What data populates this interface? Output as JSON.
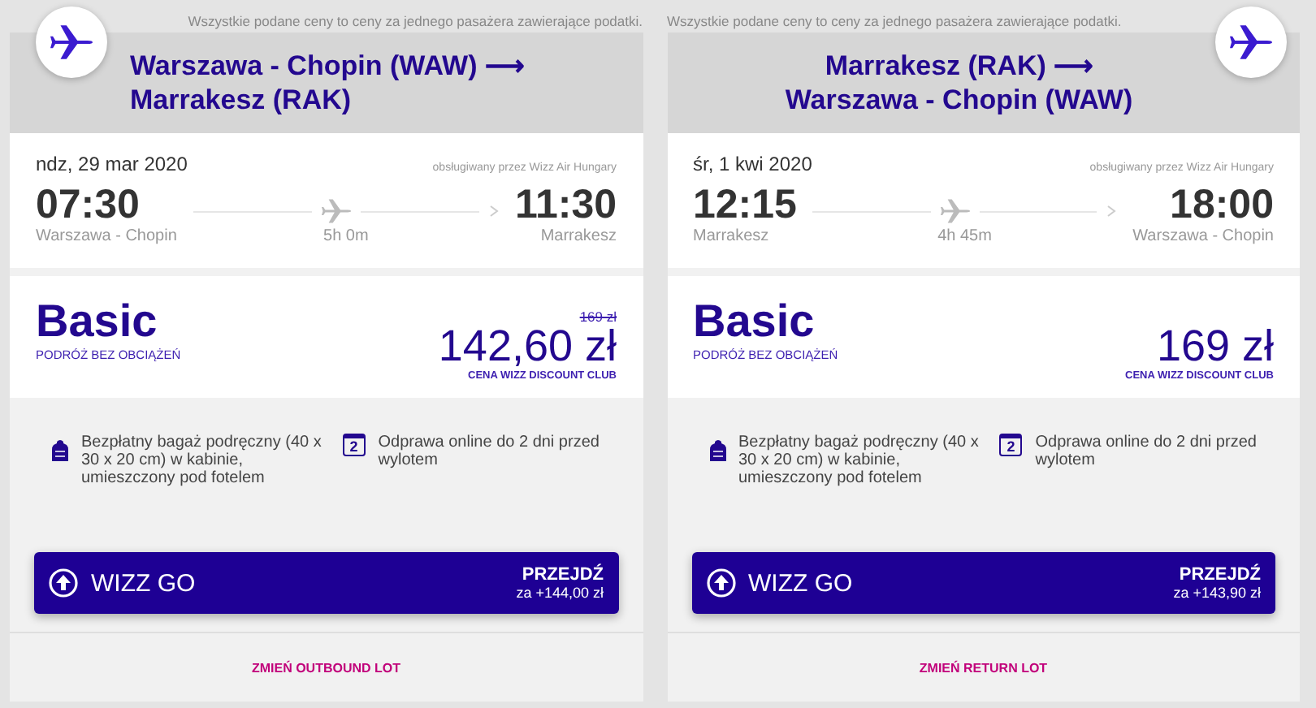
{
  "cards": [
    {
      "kind": "outbound",
      "notice": "Wszystkie podane ceny to ceny za jednego pasażera zawierające podatki.",
      "route": "Warszawa - Chopin (WAW) ⟶ Marrakesz (RAK)",
      "date": "ndz, 29 mar 2020",
      "operator": "obsługiwany przez Wizz Air Hungary",
      "departure": {
        "time": "07:30",
        "place": "Warszawa - Chopin"
      },
      "duration": "5h 0m",
      "arrival": {
        "time": "11:30",
        "place": "Marrakesz"
      },
      "fare": {
        "name": "Basic",
        "subtitle": "PODRÓŻ BEZ OBCIĄŻEŃ",
        "old_price": "169 zł",
        "price": "142,60 zł",
        "price_note": "CENA WIZZ DISCOUNT CLUB"
      },
      "features": [
        {
          "kind": "bag",
          "text": "Bezpłatny bagaż podręczny (40 x 30 x 20 cm) w kabinie, umieszczony pod fotelem"
        },
        {
          "kind": "calendar",
          "icon_text": "2",
          "text": "Odprawa online do 2 dni przed wylotem"
        }
      ],
      "upgrade": {
        "label": "WIZZ GO",
        "action": "PRZEJDŹ",
        "price": "za +144,00 zł"
      },
      "change_link": "ZMIEŃ OUTBOUND LOT"
    },
    {
      "kind": "return",
      "notice": "Wszystkie podane ceny to ceny za jednego pasażera zawierające podatki.",
      "route": "Marrakesz (RAK) ⟶ Warszawa - Chopin (WAW)",
      "date": "śr, 1 kwi 2020",
      "operator": "obsługiwany przez Wizz Air Hungary",
      "departure": {
        "time": "12:15",
        "place": "Marrakesz"
      },
      "duration": "4h 45m",
      "arrival": {
        "time": "18:00",
        "place": "Warszawa - Chopin"
      },
      "fare": {
        "name": "Basic",
        "subtitle": "PODRÓŻ BEZ OBCIĄŻEŃ",
        "price": "169 zł",
        "price_note": "CENA WIZZ DISCOUNT CLUB"
      },
      "features": [
        {
          "kind": "bag",
          "text": "Bezpłatny bagaż podręczny (40 x 30 x 20 cm) w kabinie, umieszczony pod fotelem"
        },
        {
          "kind": "calendar",
          "icon_text": "2",
          "text": "Odprawa online do 2 dni przed wylotem"
        }
      ],
      "upgrade": {
        "label": "WIZZ GO",
        "action": "PRZEJDŹ",
        "price": "za +143,90 zł"
      },
      "change_link": "ZMIEŃ RETURN LOT"
    }
  ]
}
